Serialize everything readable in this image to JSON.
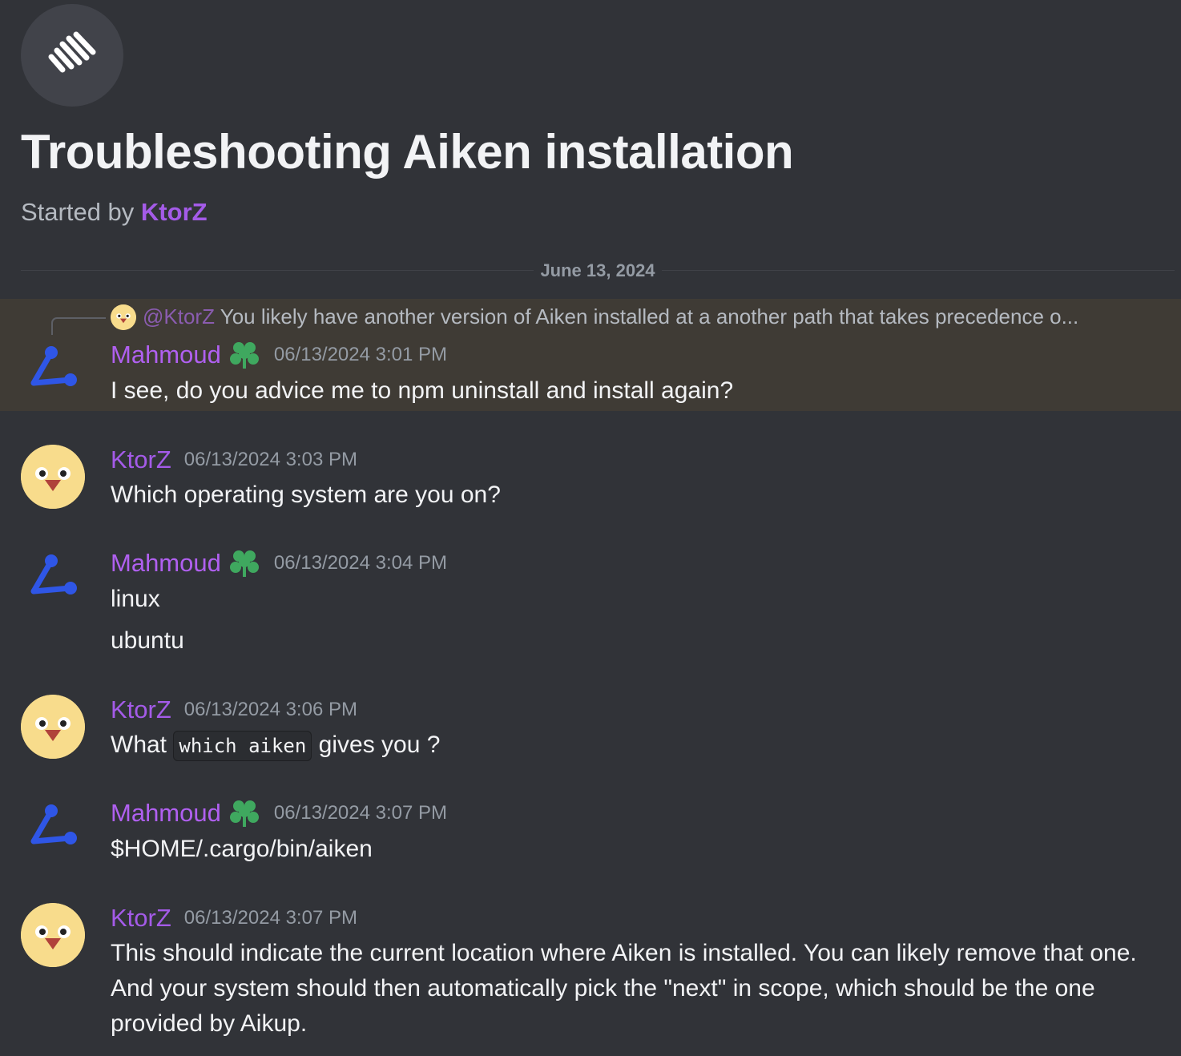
{
  "thread": {
    "title": "Troubleshooting Aiken installation",
    "started_by_prefix": "Started by ",
    "author": "KtorZ",
    "icon": "forum-thread-icon"
  },
  "divider": {
    "date": "June 13, 2024"
  },
  "reply": {
    "mention": "@KtorZ",
    "text": "You likely have another version of Aiken installed at a another path that takes precedence o..."
  },
  "messages": [
    {
      "author": "Mahmoud",
      "timestamp": "06/13/2024 3:01 PM",
      "lines": [
        "I see, do you advice me to npm uninstall and install again?"
      ],
      "highlighted": true
    },
    {
      "author": "KtorZ",
      "timestamp": "06/13/2024 3:03 PM",
      "lines": [
        "Which operating system are you on?"
      ]
    },
    {
      "author": "Mahmoud",
      "timestamp": "06/13/2024 3:04 PM",
      "lines": [
        "linux",
        "ubuntu"
      ]
    },
    {
      "author": "KtorZ",
      "timestamp": "06/13/2024 3:06 PM",
      "text_before": "What",
      "code": "which aiken",
      "text_after": "gives you ?"
    },
    {
      "author": "Mahmoud",
      "timestamp": "06/13/2024 3:07 PM",
      "lines": [
        "$HOME/.cargo/bin/aiken"
      ]
    },
    {
      "author": "KtorZ",
      "timestamp": "06/13/2024 3:07 PM",
      "lines": [
        "This should indicate the current location where Aiken is installed. You can likely remove that one. And your system should then automatically pick the \"next\" in scope, which should be the one provided by Aikup."
      ]
    }
  ],
  "colors": {
    "background": "#313338",
    "username": "#a45be8",
    "highlight": "#3f3b35",
    "mahmoud_avatar": "#2f56e6",
    "role_icon": "#3fa85f"
  }
}
